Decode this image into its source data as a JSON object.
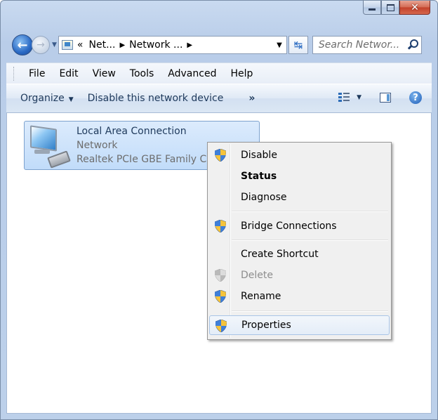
{
  "window": {
    "caption": {
      "minimize": "minimize",
      "maximize": "maximize",
      "close": "close"
    }
  },
  "address": {
    "crumbs": [
      "«",
      "Net...",
      "Network ..."
    ],
    "search_placeholder": "Search Networ..."
  },
  "menubar": {
    "items": [
      "File",
      "Edit",
      "View",
      "Tools",
      "Advanced",
      "Help"
    ]
  },
  "commandbar": {
    "organize": "Organize",
    "disable_device": "Disable this network device",
    "more": "»"
  },
  "adapter": {
    "name": "Local Area Connection",
    "type": "Network",
    "device": "Realtek PCIe GBE Family C"
  },
  "context_menu": {
    "items": [
      {
        "label": "Disable",
        "icon": "uac-shield-icon"
      },
      {
        "label": "Status",
        "bold": true
      },
      {
        "label": "Diagnose"
      },
      {
        "label": "Bridge Connections",
        "icon": "uac-shield-icon"
      },
      {
        "label": "Create Shortcut"
      },
      {
        "label": "Delete",
        "icon": "uac-shield-icon",
        "disabled": true
      },
      {
        "label": "Rename",
        "icon": "uac-shield-icon"
      },
      {
        "label": "Properties",
        "icon": "uac-shield-icon",
        "highlighted": true
      }
    ]
  },
  "colors": {
    "frame": "#c9daf0",
    "selection": "#c1dcfa",
    "close_button": "#c2412a",
    "menu_background": "#f0f0f0"
  }
}
